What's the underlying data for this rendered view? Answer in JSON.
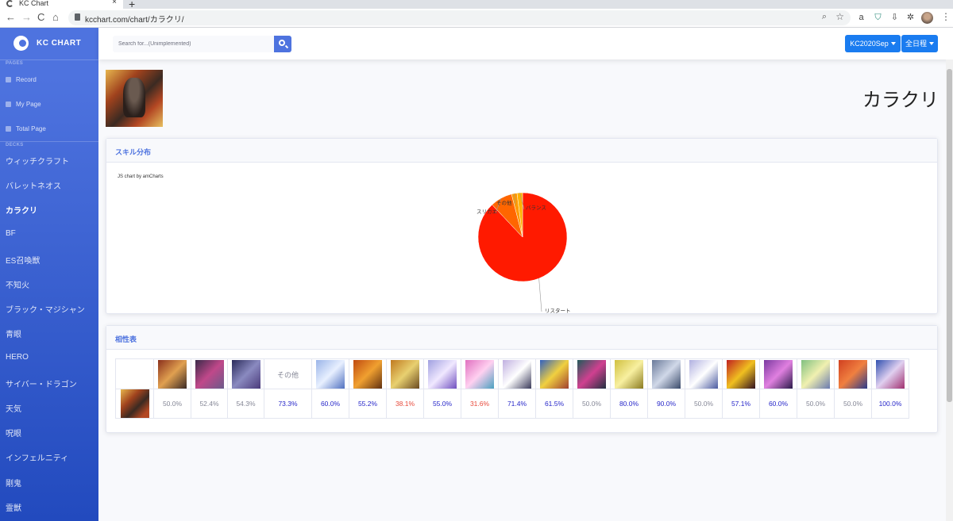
{
  "browser": {
    "tab_title": "KC Chart",
    "tab_close": "×",
    "new_tab": "+",
    "url": "kcchart.com/chart/カラクリ/",
    "nav": {
      "back": "←",
      "forward": "→",
      "reload": "C",
      "home": "⌂"
    }
  },
  "sidebar": {
    "brand": "KC CHART",
    "pages_heading": "PAGES",
    "pages": [
      {
        "label": "Record",
        "icon": "paper-plane-icon"
      },
      {
        "label": "My Page",
        "icon": "user-icon"
      },
      {
        "label": "Total Page",
        "icon": "users-icon"
      }
    ],
    "decks_heading": "DECKS",
    "decks": [
      {
        "label": "ウィッチクラフト"
      },
      {
        "label": "バレットネオス"
      },
      {
        "label": "カラクリ",
        "active": true
      },
      {
        "label": "BF"
      },
      {
        "label": "ES召喚獣"
      },
      {
        "label": "不知火"
      },
      {
        "label": "ブラック・マジシャン"
      },
      {
        "label": "青眼"
      },
      {
        "label": "HERO"
      },
      {
        "label": "サイバー・ドラゴン"
      },
      {
        "label": "天気"
      },
      {
        "label": "呪眼"
      },
      {
        "label": "インフェルニティ"
      },
      {
        "label": "剛鬼"
      },
      {
        "label": "霊獣"
      }
    ]
  },
  "topbar": {
    "search_placeholder": "Search for...(Unimplemented)",
    "season_button": "KC2020Sep",
    "range_button": "全日程"
  },
  "deck": {
    "title": "カラクリ"
  },
  "skill_card": {
    "title": "スキル分布",
    "credit": "JS chart by amCharts"
  },
  "chart_data": {
    "type": "pie",
    "categories": [
      "リスタート",
      "スリカエ",
      "その他",
      "バランス"
    ],
    "values": [
      88,
      8,
      2,
      2
    ],
    "colors": [
      "#ff1a00",
      "#ff6600",
      "#ff9900",
      "#ffb000"
    ]
  },
  "matchup_card": {
    "title": "相性表",
    "other_label": "その他",
    "matchups": [
      {
        "value": "50.0%",
        "tone": "neutral"
      },
      {
        "value": "52.4%",
        "tone": "neutral"
      },
      {
        "value": "54.3%",
        "tone": "neutral"
      },
      {
        "value": "73.3%",
        "tone": "good",
        "other": true
      },
      {
        "value": "60.0%",
        "tone": "good"
      },
      {
        "value": "55.2%",
        "tone": "good"
      },
      {
        "value": "38.1%",
        "tone": "bad"
      },
      {
        "value": "55.0%",
        "tone": "good"
      },
      {
        "value": "31.6%",
        "tone": "bad"
      },
      {
        "value": "71.4%",
        "tone": "good"
      },
      {
        "value": "61.5%",
        "tone": "good"
      },
      {
        "value": "50.0%",
        "tone": "neutral"
      },
      {
        "value": "80.0%",
        "tone": "good"
      },
      {
        "value": "90.0%",
        "tone": "good"
      },
      {
        "value": "50.0%",
        "tone": "neutral"
      },
      {
        "value": "57.1%",
        "tone": "good"
      },
      {
        "value": "60.0%",
        "tone": "good"
      },
      {
        "value": "50.0%",
        "tone": "neutral"
      },
      {
        "value": "50.0%",
        "tone": "neutral"
      },
      {
        "value": "100.0%",
        "tone": "good"
      }
    ]
  }
}
